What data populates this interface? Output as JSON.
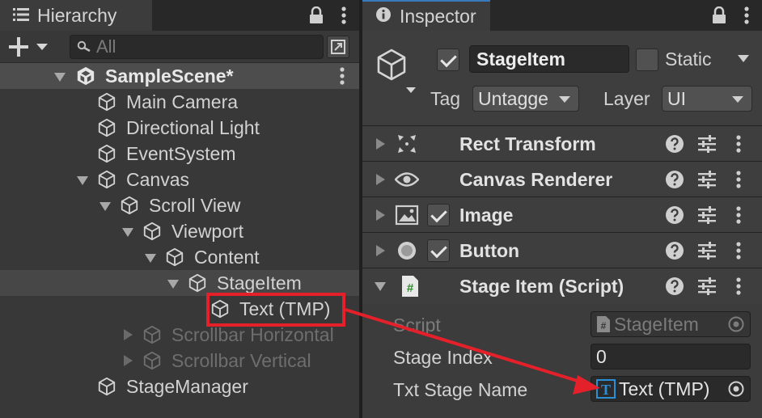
{
  "hierarchy": {
    "tab_label": "Hierarchy",
    "search_placeholder": "All",
    "scene": {
      "label": "SampleScene*"
    },
    "items": [
      {
        "label": "Main Camera"
      },
      {
        "label": "Directional Light"
      },
      {
        "label": "EventSystem"
      },
      {
        "label": "Canvas"
      },
      {
        "label": "Scroll View"
      },
      {
        "label": "Viewport"
      },
      {
        "label": "Content"
      },
      {
        "label": "StageItem"
      },
      {
        "label": "Text (TMP)"
      },
      {
        "label": "Scrollbar Horizontal"
      },
      {
        "label": "Scrollbar Vertical"
      },
      {
        "label": "StageManager"
      }
    ]
  },
  "inspector": {
    "tab_label": "Inspector",
    "object_name": "StageItem",
    "static_label": "Static",
    "tag_label": "Tag",
    "tag_value": "Untagge",
    "layer_label": "Layer",
    "layer_value": "UI",
    "components": [
      {
        "title": "Rect Transform",
        "icon": "rect-transform-icon"
      },
      {
        "title": "Canvas Renderer",
        "icon": "eye-icon"
      },
      {
        "title": "Image",
        "icon": "image-icon"
      },
      {
        "title": "Button",
        "icon": "button-icon"
      },
      {
        "title": "Stage Item (Script)",
        "icon": "csharp-script-icon"
      }
    ],
    "script_props": {
      "script_label": "Script",
      "script_value": "StageItem",
      "stage_index_label": "Stage Index",
      "stage_index_value": "0",
      "txt_stage_name_label": "Txt Stage Name",
      "txt_stage_name_value": "Text (TMP)"
    }
  },
  "colors": {
    "panel_bg": "#383838",
    "selection": "#474747",
    "annotation": "#e4202a",
    "tmp_icon": "#2b8fd6"
  }
}
